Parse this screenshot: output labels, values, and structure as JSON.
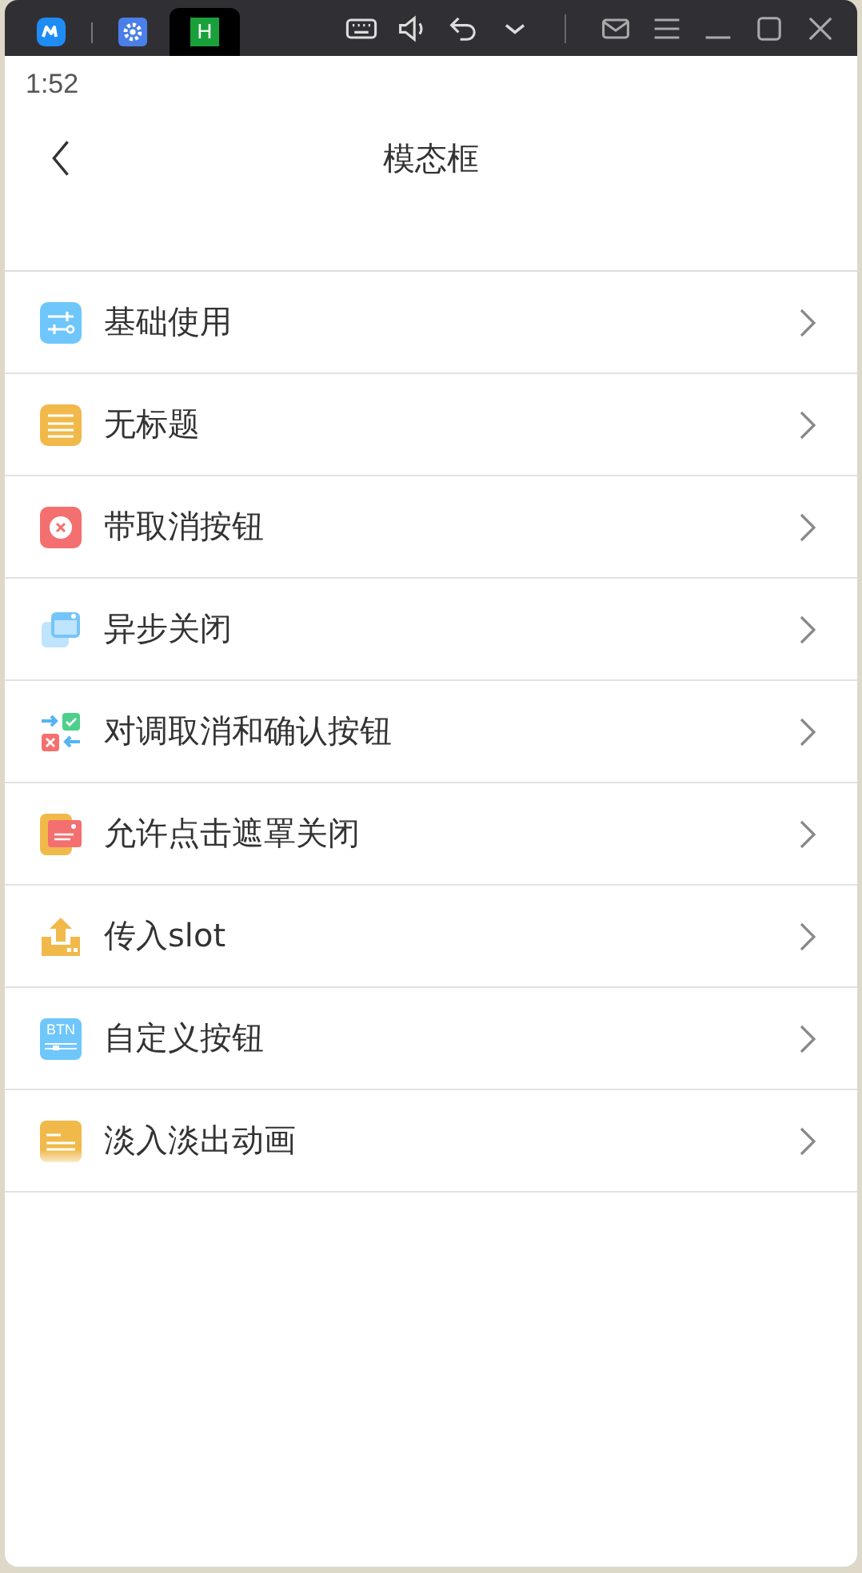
{
  "window": {
    "tabs": [
      {
        "kind": "app",
        "selected": false
      },
      {
        "kind": "settings",
        "selected": false
      },
      {
        "kind": "letter",
        "label": "H",
        "selected": true
      }
    ]
  },
  "status_bar": {
    "time": "1:52"
  },
  "nav_bar": {
    "title": "模态框"
  },
  "menu": [
    {
      "kind": "sliders",
      "label": "基础使用"
    },
    {
      "kind": "note",
      "label": "无标题"
    },
    {
      "kind": "cancel",
      "label": "带取消按钮"
    },
    {
      "kind": "windows",
      "label": "异步关闭"
    },
    {
      "kind": "swap",
      "label": "对调取消和确认按钮"
    },
    {
      "kind": "card",
      "label": "允许点击遮罩关闭"
    },
    {
      "kind": "upload",
      "label": "传入slot"
    },
    {
      "kind": "btn",
      "label": "自定义按钮",
      "icon_label": "BTN"
    },
    {
      "kind": "fade",
      "label": "淡入淡出动画"
    }
  ]
}
